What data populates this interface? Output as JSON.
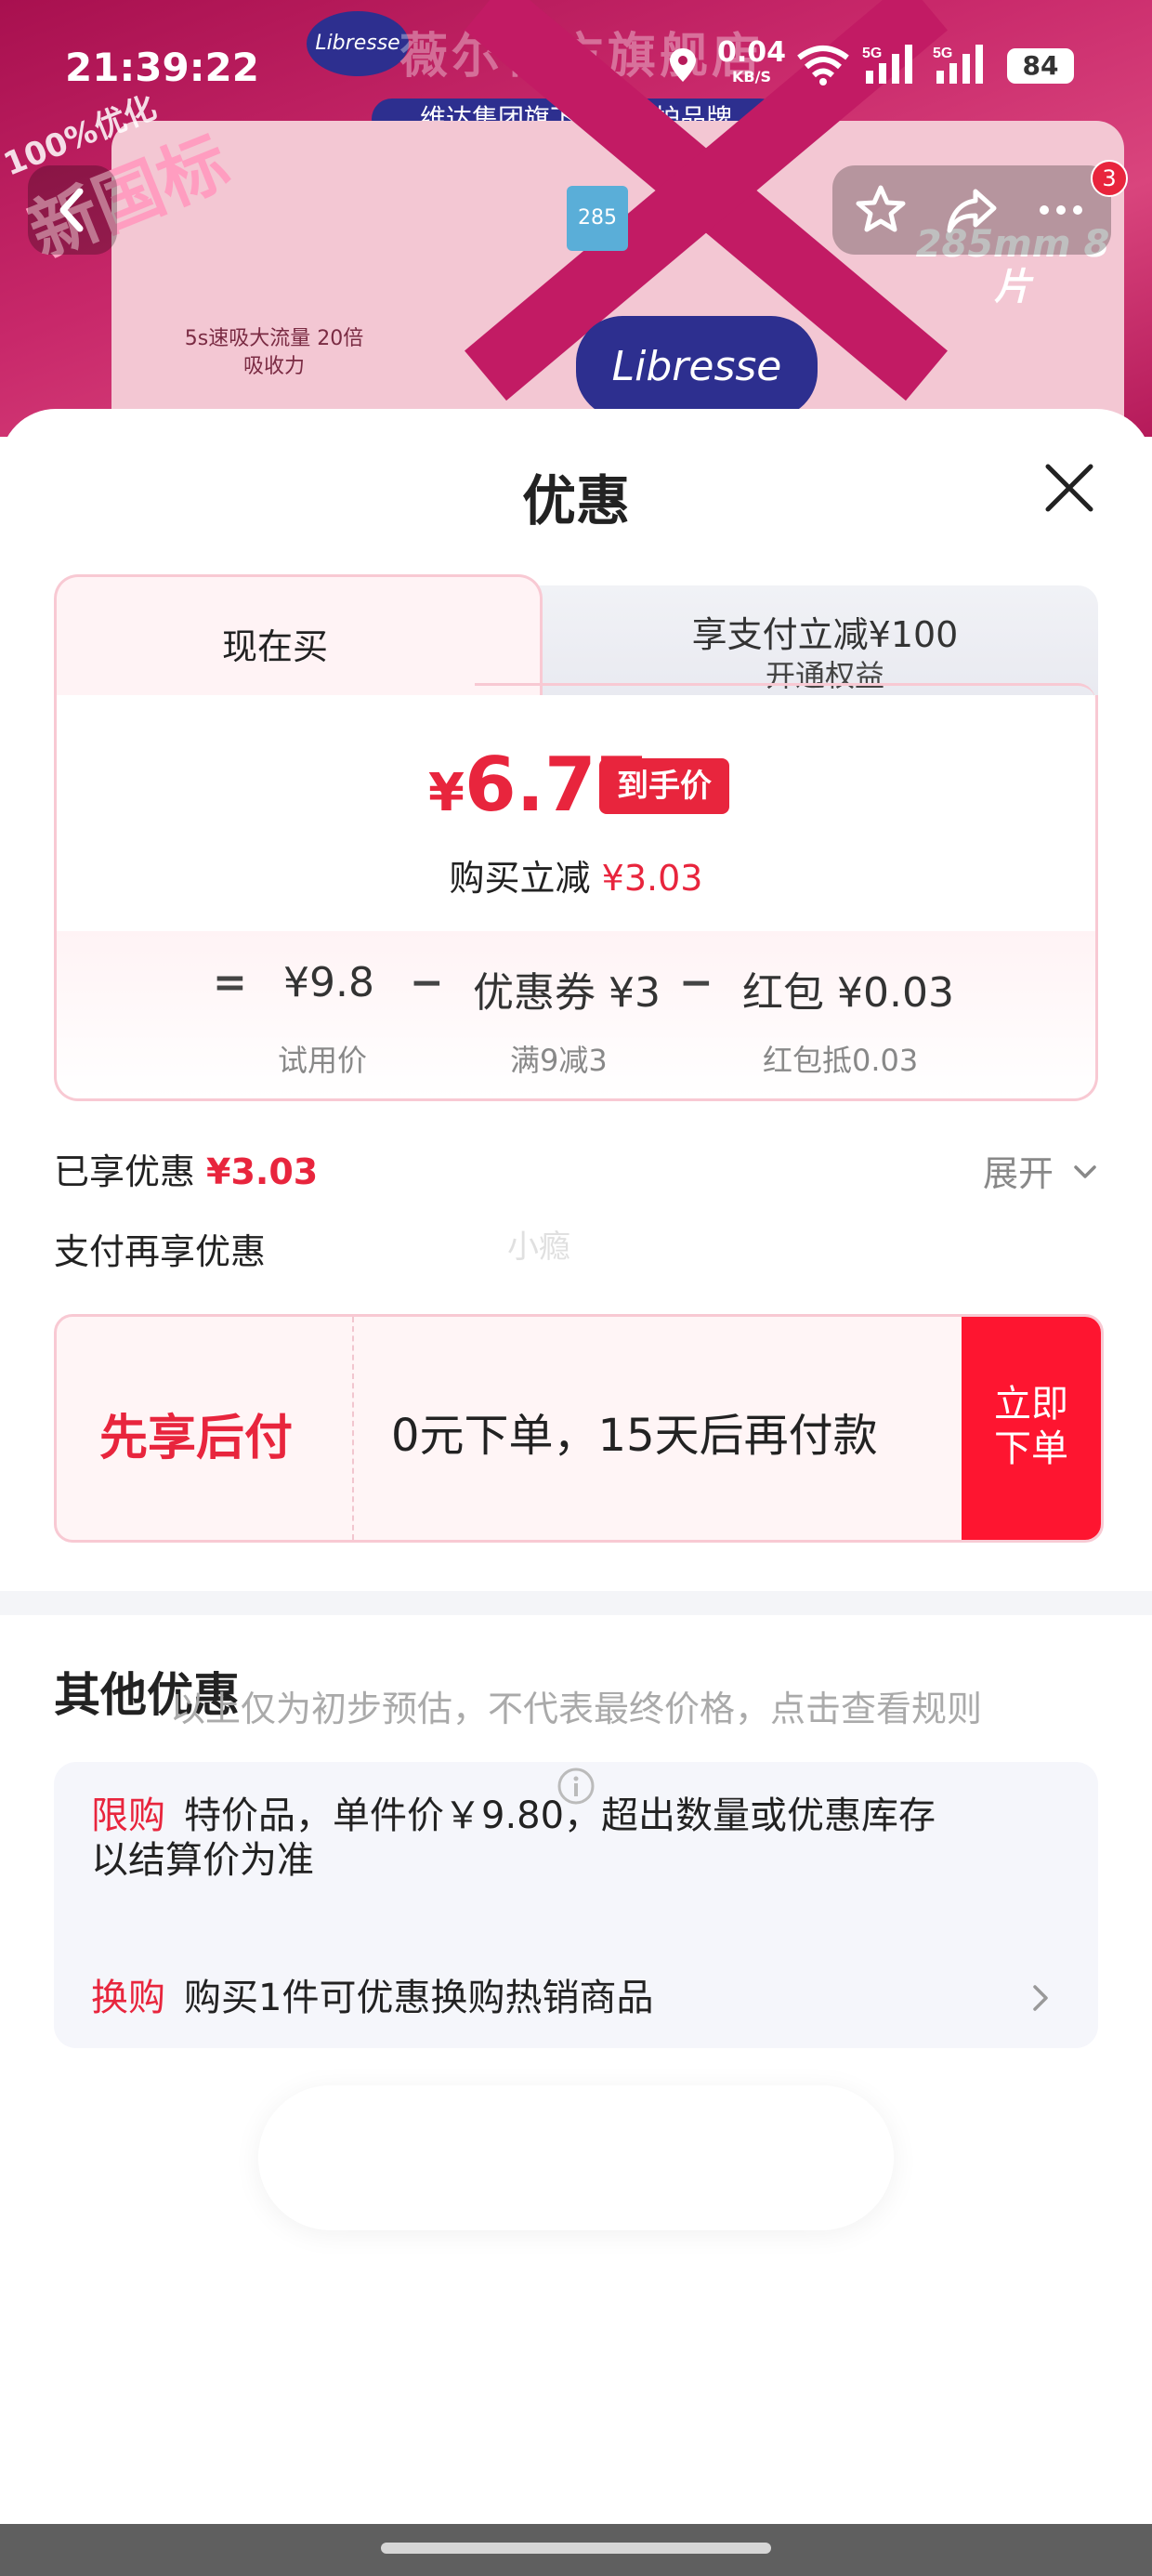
{
  "status_bar": {
    "time": "21:39:22",
    "net_speed": "0.04",
    "net_unit": "KB/S",
    "sim1": "5G",
    "sim2": "5G",
    "battery": "84"
  },
  "hero": {
    "store_title": "薇尔官方旗舰店",
    "store_subtitle": "维达集团旗下高端女护品牌",
    "logo_text": "Libresse",
    "badge_line1": "100%优化",
    "badge_line2": "新国标",
    "flow_text": "5s速吸大流量 20倍吸收力",
    "size_text": "285mm 8片",
    "box_text": "285",
    "product_logo": "Libresse",
    "notification_count": "3"
  },
  "sheet": {
    "title": "优惠",
    "tabs": {
      "now": "现在买",
      "pay_line1": "享支付立减¥100",
      "pay_line2": "开通权益"
    },
    "final_price": {
      "currency": "¥",
      "value": "6.77",
      "tag": "到手价"
    },
    "reduce": {
      "label": "购买立减",
      "value": "¥3.03"
    },
    "calc": {
      "eq": "=",
      "minus": "−",
      "trial_price": "¥9.8",
      "trial_note": "试用价",
      "coupon": "优惠券 ¥3",
      "coupon_note": "满9减3",
      "redpack": "红包 ¥0.03",
      "redpack_note": "红包抵0.03"
    },
    "enjoyed": {
      "label": "已享优惠",
      "value": "¥3.03",
      "expand": "展开"
    },
    "pay_more": "支付再享优惠",
    "watermark": "小瘾",
    "bnpl": {
      "label": "先享后付",
      "desc": "0元下单，15天后再付款",
      "buy_line1": "立即",
      "buy_line2": "下单"
    },
    "other": {
      "title": "其他优惠",
      "rows": [
        {
          "tag": "限购",
          "text": "特价品，单件价￥9.80，超出数量或优惠库存",
          "text2": "以结算价为准"
        },
        {
          "tag": "换购",
          "text": "购买1件可优惠换购热销商品"
        }
      ]
    },
    "rules": "以上仅为初步预估，不代表最终价格，点击查看规则"
  },
  "colors": {
    "accent_red": "#e8253d",
    "buy_button": "#fe1530",
    "panel_border": "#f8c9d3",
    "hero_magenta": "#c21b64"
  }
}
